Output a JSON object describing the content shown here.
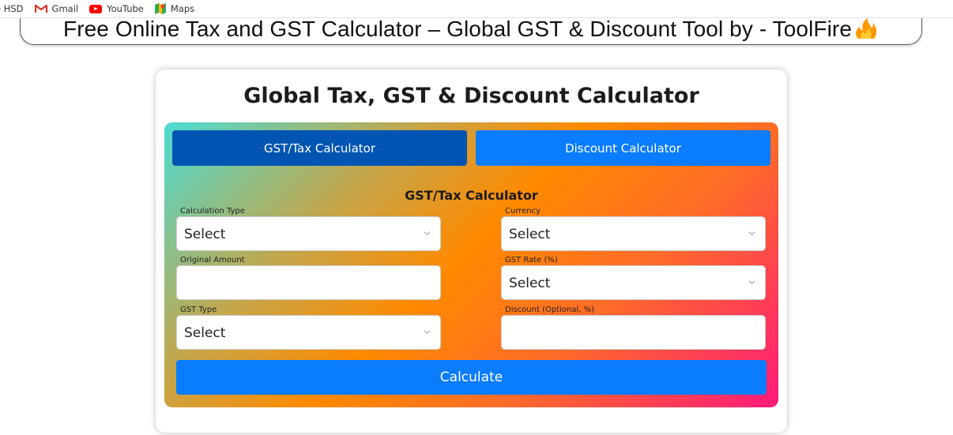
{
  "bookmarks": [
    {
      "label": "e HSD",
      "icon": "none"
    },
    {
      "label": "Gmail",
      "icon": "gmail-icon"
    },
    {
      "label": "YouTube",
      "icon": "youtube-icon"
    },
    {
      "label": "Maps",
      "icon": "maps-icon"
    }
  ],
  "banner": {
    "title": "Free Online Tax and GST Calculator – Global GST & Discount Tool by - ToolFire",
    "icon": "fire-icon"
  },
  "card": {
    "title": "Global Tax, GST & Discount Calculator"
  },
  "tabs": [
    {
      "label": "GST/Tax Calculator",
      "active": true
    },
    {
      "label": "Discount Calculator",
      "active": false
    }
  ],
  "form": {
    "title": "GST/Tax Calculator",
    "calculation_type": {
      "label": "Calculation Type",
      "value": "Select"
    },
    "currency": {
      "label": "Currency",
      "value": "Select"
    },
    "original_amount": {
      "label": "Original Amount",
      "value": ""
    },
    "gst_rate": {
      "label": "GST Rate (%)",
      "value": "Select"
    },
    "gst_type": {
      "label": "GST Type",
      "value": "Select"
    },
    "discount": {
      "label": "Discount (Optional, %)",
      "value": ""
    },
    "calculate_label": "Calculate"
  },
  "colors": {
    "tab_active": "#0055b3",
    "tab_inactive": "#0a7cff",
    "button": "#0a7cff"
  }
}
